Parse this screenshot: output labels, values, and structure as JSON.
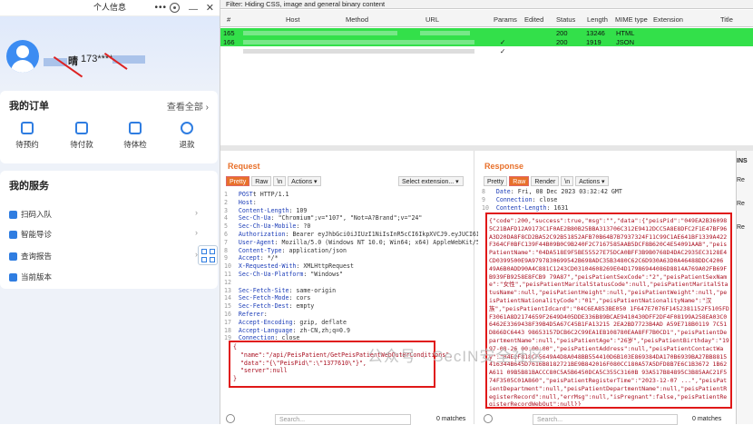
{
  "mobile": {
    "title": "个人信息",
    "user_name_suffix": "晴",
    "user_phone": "173****",
    "order_section": {
      "title": "我的订单",
      "view_all": "查看全部"
    },
    "order_items": [
      {
        "label": "待预约",
        "icon": "calendar-icon"
      },
      {
        "label": "待付款",
        "icon": "wallet-icon"
      },
      {
        "label": "待体检",
        "icon": "clipboard-icon"
      },
      {
        "label": "退款",
        "icon": "refund-icon"
      }
    ],
    "service_section": {
      "title": "我的服务"
    },
    "service_items": [
      {
        "label": "扫码入队"
      },
      {
        "label": "智能导诊"
      },
      {
        "label": "查询报告"
      },
      {
        "label": "当前版本"
      }
    ]
  },
  "burp": {
    "filter": "Filter: Hiding CSS, image and general binary content",
    "columns": [
      "#",
      "Host",
      "Method",
      "URL",
      "Params",
      "Edited",
      "Status",
      "Length",
      "MIME type",
      "Extension",
      "Title"
    ],
    "rows": [
      {
        "num": "165",
        "params": "",
        "status": "200",
        "length": "13246",
        "mime": "HTML"
      },
      {
        "num": "166",
        "params": "✓",
        "status": "200",
        "length": "1919",
        "mime": "JSON"
      },
      {
        "num": "",
        "params": "✓",
        "status": "",
        "length": "",
        "mime": ""
      }
    ],
    "request": {
      "title": "Request",
      "tabs": [
        "Pretty",
        "Raw",
        "\\n",
        "Actions ▾"
      ],
      "select": "Select extension...",
      "lines": [
        {
          "n": "1",
          "k": "POST",
          "v": "t HTTP/1.1"
        },
        {
          "n": "2",
          "k": "Host",
          "v": ":"
        },
        {
          "n": "3",
          "k": "Content-Length",
          "v": ": 109"
        },
        {
          "n": "4",
          "k": "Sec-Ch-Ua",
          "v": ": \"Chromium\";v=\"107\", \"Not=A?Brand\";v=\"24\""
        },
        {
          "n": "5",
          "k": "Sec-Ch-Ua-Mobile",
          "v": ": ?0"
        },
        {
          "n": "6",
          "k": "Authorization",
          "v": ": Bearer eyJhbGci0iJIUzI1NiIsInR5cCI6IkpXVCJ9.eyJUCI6IjE3Mz"
        },
        {
          "n": "7",
          "k": "User-Agent",
          "v": ": Mozilla/5.0 (Windows NT 10.0; Win64; x64) AppleWebKit/537.36"
        },
        {
          "n": "8",
          "k": "Content-Type",
          "v": ": application/json"
        },
        {
          "n": "9",
          "k": "Accept",
          "v": ": */*"
        },
        {
          "n": "10",
          "k": "X-Requested-With",
          "v": ": XMLHttpRequest"
        },
        {
          "n": "11",
          "k": "Sec-Ch-Ua-Platform",
          "v": ": \"Windows\""
        },
        {
          "n": "12",
          "k": "",
          "v": ""
        },
        {
          "n": "13",
          "k": "Sec-Fetch-Site",
          "v": ": same-origin"
        },
        {
          "n": "14",
          "k": "Sec-Fetch-Mode",
          "v": ": cors"
        },
        {
          "n": "15",
          "k": "Sec-Fetch-Dest",
          "v": ": empty"
        },
        {
          "n": "16",
          "k": "Referer",
          "v": ":"
        },
        {
          "n": "17",
          "k": "Accept-Encoding",
          "v": ": gzip, deflate"
        },
        {
          "n": "18",
          "k": "Accept-Language",
          "v": ": zh-CN,zh;q=0.9"
        },
        {
          "n": "19",
          "k": "Connection",
          "v": ": close"
        }
      ],
      "body_lines": [
        "{",
        "  \"name\":\"/api/PeisPatient/GetPeisPatientWebOutBrConditions\",",
        "  \"data\":\"{\\\"PeisPid\\\":\\\"1377610\\\"}\",",
        "  \"server\":null",
        "}"
      ],
      "search_placeholder": "Search...",
      "matches": "0 matches"
    },
    "response": {
      "title": "Response",
      "tabs": [
        "Pretty",
        "Raw",
        "Render",
        "\\n",
        "Actions ▾"
      ],
      "lines": [
        {
          "n": "8",
          "k": "Date",
          "v": ": Fri, 08 Dec 2023 03:32:42 GMT"
        },
        {
          "n": "9",
          "k": "Connection",
          "v": ": close"
        },
        {
          "n": "10",
          "k": "Content-Length",
          "v": ": 1631"
        }
      ],
      "json_body": "{\"code\":200,\"success\":true,\"msg\":\"\",\"data\":{\"peisPid\":\"049EA2B360985C21BAFD12A9173C1F0AE2B80B25BBA313706C312E9412DCC5A8E8DFC2F1E47BF96A3D20DA8F8CD2BA52C92B51852AFB70B64B7B7937324F11C99C1AE641BF1339A422F364CF0BFC139F44B09B0C9B240F2C7167585AAB5DCF8B620C4E54091AAB\",\"peisPatientName\":\"04DA518E9F5BE55527E75DCA0BFF3B9B0768D4DAC2935EC3128E4CD0399500E9A9797830699542B698ADC35B3480C62C6D930A63D0A46488DDC4206 49A6B0ADD90A4C881C1243CD03104608269E04D17986944086D8814A769A02FB69FB939FB9258E8FCB9 79A87\",\"peisPatientSexCode\":\"2\",\"peisPatientSexName\":\"女性\",\"peisPatientMaritalStatusCode\":null,\"peisPatientMaritalStatusName\":null,\"peisPatientHeight\":null,\"peisPatientWeight\":null,\"peisPatientNationalityCode\":\"01\",\"peisPatientNationalityName\":\"汉族\",\"peisPatientIdcard\":\"04C6EA853BE050 1F647E7076F1452381152F5105FDF3061A8D2174659F2649D405DDE336B89BCAE9410430DFF2DF4F08199A258EA03C06462E3369438F39B4D5A67C45B1FA13215 2EA2BD7723B4AD A59E718B0119 7C51D866DC6443 98653157DCB6C2C99EA1EB108780EAA8FF7B0CD1\",\"peisPatientDepartmentName\":null,\"peisPatientAge\":\"26岁\",\"peisPatientBirthday\":\"1997-08-26 00:00:00\",\"peisPatientAddress\":null,\"peisPatientContactWay\":\"04E2F818CF5649A4D8A048BB554410D6B103E869384DA170B6939BA27BB8815416344B645D7616B8182721BE9B842016F080CC180A57A5DFD8B7E6C1B3672 1B62A611 09B5B81BACCC80C5A5B6450DCA5C355C3160B 93A517B84895C3B85AAC21F574F3505C01A860\",\"peisPatientRegisterTime\":\"2023-12-07 ...\",\"peisPatientDepartment\":null,\"peisPatientDepartmentName\":null,\"peisPatientRegisterRecord\":null,\"errMsg\":null,\"isPregnant\":false,\"peisPatientRegisterRecordWebOut\":null}}",
      "search_placeholder": "Search...",
      "matches": "0 matches"
    },
    "inspector": {
      "title": "INS",
      "items": [
        "Re",
        "Re",
        "Re"
      ]
    }
  },
  "watermark": "公众号 · SecIN安全社区"
}
